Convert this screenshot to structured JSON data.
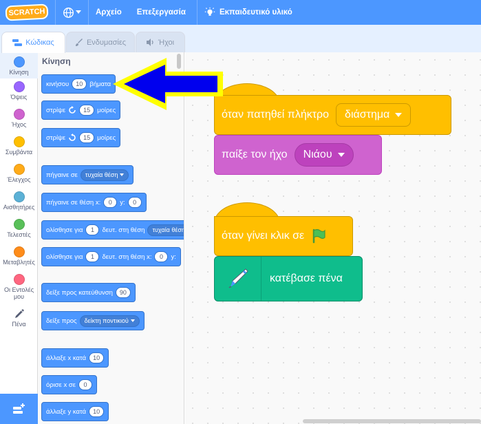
{
  "menubar": {
    "logo_text": "SCRATCH",
    "file": "Αρχείο",
    "edit": "Επεξεργασία",
    "tutorials": "Εκπαιδευτικό υλικό",
    "color": "#4c97ff"
  },
  "tabs": [
    {
      "label": "Κώδικας",
      "icon": "code-icon",
      "active": true
    },
    {
      "label": "Ενδυμασίες",
      "icon": "brush-icon",
      "active": false
    },
    {
      "label": "Ήχοι",
      "icon": "speaker-icon",
      "active": false
    }
  ],
  "categories": [
    {
      "label": "Κίνηση",
      "color": "#4c97ff"
    },
    {
      "label": "Όψεις",
      "color": "#9966ff"
    },
    {
      "label": "Ήχος",
      "color": "#cf63cf"
    },
    {
      "label": "Συμβάντα",
      "color": "#ffbf00"
    },
    {
      "label": "Έλεγχος",
      "color": "#ffab19"
    },
    {
      "label": "Αισθητήρες",
      "color": "#5cb1d6"
    },
    {
      "label": "Τελεστές",
      "color": "#59c059"
    },
    {
      "label": "Μεταβλητές",
      "color": "#ff8c1a"
    },
    {
      "label": "Οι Εντολές μου",
      "color": "#ff6680"
    },
    {
      "label": "Πένα",
      "icon": "pen-icon"
    }
  ],
  "palette": {
    "title": "Κίνηση",
    "move": {
      "text1": "κινήσου",
      "value": "10",
      "text2": "βήματα"
    },
    "turn_right": {
      "text1": "στρίψε",
      "value": "15",
      "text2": "μοίρες"
    },
    "turn_left": {
      "text1": "στρίψε",
      "value": "15",
      "text2": "μοίρες"
    },
    "goto": {
      "text1": "πήγαινε σε",
      "dropdown": "τυχαία θέση"
    },
    "goto_xy": {
      "text1": "πήγαινε σε θέση x:",
      "x": "0",
      "text2": "y:",
      "y": "0"
    },
    "glide": {
      "text1": "ολίσθησε για",
      "value": "1",
      "text2": "δευτ. στη θέση",
      "dropdown": "τυχαία θέση"
    },
    "glide_xy": {
      "text1": "ολίσθησε για",
      "value": "1",
      "text2": "δευτ. στη θέση x:",
      "x": "0",
      "text3": "y:"
    },
    "point_dir": {
      "text1": "δείξε προς κατεύθυνση",
      "value": "90"
    },
    "point_towards": {
      "text1": "δείξε προς",
      "dropdown": "δείκτη ποντικιού"
    },
    "change_x": {
      "text1": "άλλαξε x κατά",
      "value": "10"
    },
    "set_x": {
      "text1": "όρισε x σε",
      "value": "0"
    },
    "change_y": {
      "text1": "άλλαξε y κατά",
      "value": "10"
    }
  },
  "workspace": {
    "key_hat": {
      "text": "όταν πατηθεί πλήκτρο",
      "dropdown": "διάστημα"
    },
    "play_sound": {
      "text": "παίξε τον ήχο",
      "dropdown": "Νιάου"
    },
    "flag_hat": {
      "text": "όταν γίνει κλικ σε"
    },
    "pen_down": {
      "text": "κατέβασε πένα"
    }
  }
}
